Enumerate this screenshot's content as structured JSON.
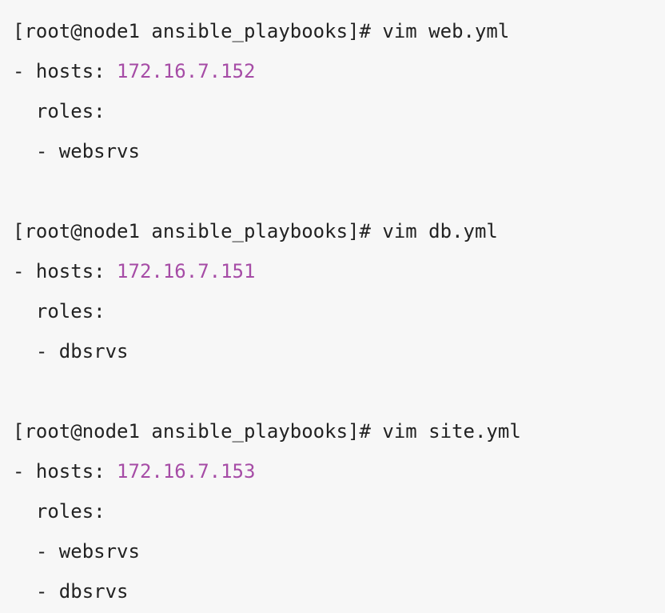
{
  "terminal": {
    "background_color": "#f7f7f7",
    "text_color": "#222222",
    "ip_color": "#a64ca6",
    "prompt": "[root@node1 ansible_playbooks]#",
    "blocks": [
      {
        "command_line": "[root@node1 ansible_playbooks]# vim web.yml",
        "command": "vim web.yml",
        "file": "web.yml",
        "hosts_label": "- hosts: ",
        "hosts_ip": "172.16.7.152",
        "roles_label": "  roles:",
        "roles": [
          "  - websrvs"
        ]
      },
      {
        "command_line": "[root@node1 ansible_playbooks]# vim db.yml",
        "command": "vim db.yml",
        "file": "db.yml",
        "hosts_label": "- hosts: ",
        "hosts_ip": "172.16.7.151",
        "roles_label": "  roles:",
        "roles": [
          "  - dbsrvs"
        ]
      },
      {
        "command_line": "[root@node1 ansible_playbooks]# vim site.yml",
        "command": "vim site.yml",
        "file": "site.yml",
        "hosts_label": "- hosts: ",
        "hosts_ip": "172.16.7.153",
        "roles_label": "  roles:",
        "roles": [
          "  - websrvs",
          "  - dbsrvs"
        ]
      }
    ]
  }
}
